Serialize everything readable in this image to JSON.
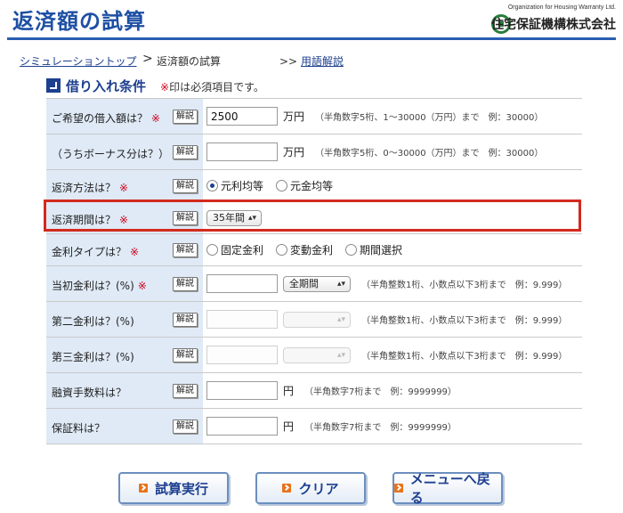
{
  "header": {
    "title": "返済額の試算",
    "brand_en": "Organization for Housing Warranty Ltd.",
    "brand_jp": "住宅保証機構株式会社"
  },
  "breadcrumb": {
    "top_link": "シミュレーショントップ",
    "separator": ">",
    "current": "返済額の試算",
    "glossary_prefix": ">>",
    "glossary_link": "用語解説"
  },
  "section": {
    "title": "借り入れ条件",
    "note_star": "※",
    "note_text": "印は必須項目です。"
  },
  "help_label": "解説",
  "required_mark": "※",
  "rows": {
    "loan_amount": {
      "label": "ご希望の借入額は？",
      "value": "2500",
      "unit": "万円",
      "hint": "（半角数字5桁、1〜30000（万円）まで　例：30000）"
    },
    "bonus": {
      "label": "（うちボーナス分は？）",
      "value": "",
      "unit": "万円",
      "hint": "（半角数字5桁、0〜30000（万円）まで　例：30000）"
    },
    "method": {
      "label": "返済方法は？",
      "options": [
        "元利均等",
        "元金均等"
      ],
      "selected": 0
    },
    "period": {
      "label": "返済期間は？",
      "selected": "35年間"
    },
    "rate_type": {
      "label": "金利タイプは？",
      "options": [
        "固定金利",
        "変動金利",
        "期間選択"
      ],
      "selected": -1
    },
    "initial_rate": {
      "label": "当初金利は？(%)",
      "value": "",
      "select": "全期間",
      "hint": "（半角整数1桁、小数点以下3桁まで　例：9.999）"
    },
    "second_rate": {
      "label": "第二金利は？(%)",
      "value": "",
      "hint": "（半角整数1桁、小数点以下3桁まで　例：9.999）"
    },
    "third_rate": {
      "label": "第三金利は？(%)",
      "value": "",
      "hint": "（半角整数1桁、小数点以下3桁まで　例：9.999）"
    },
    "loan_fee": {
      "label": "融資手数料は？",
      "value": "",
      "unit": "円",
      "hint": "（半角数字7桁まで　例：9999999）"
    },
    "guarantee_fee": {
      "label": "保証料は？",
      "value": "",
      "unit": "円",
      "hint": "（半角数字7桁まで　例：9999999）"
    }
  },
  "buttons": {
    "run": "試算実行",
    "clear": "クリア",
    "menu": "メニューへ戻る"
  },
  "colors": {
    "brand_blue": "#1d4fa3",
    "label_bg": "#dfeaf6",
    "required_red": "#d0021b",
    "highlight_red": "#d32a1e"
  }
}
